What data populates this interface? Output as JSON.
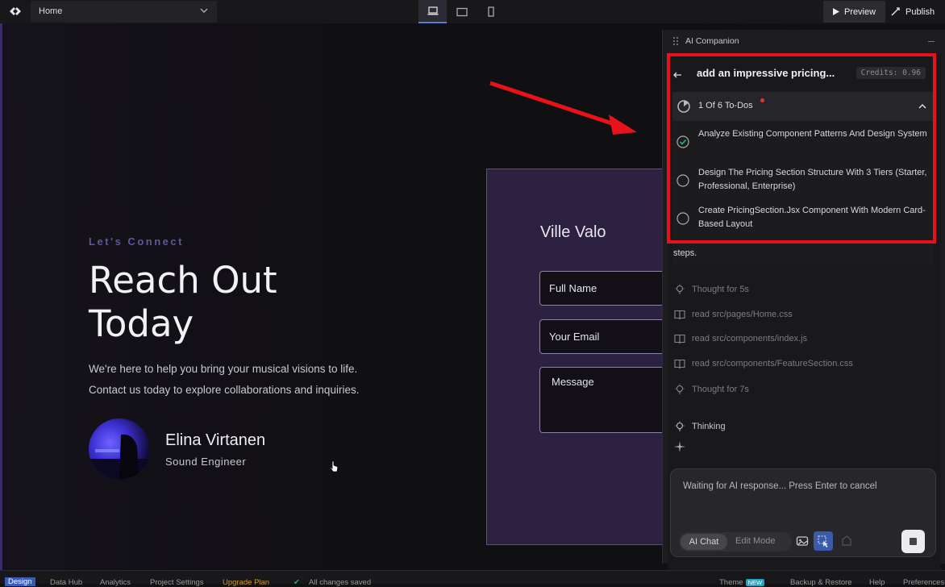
{
  "topbar": {
    "page_select": "Home",
    "preview_label": "Preview",
    "publish_label": "Publish"
  },
  "canvas": {
    "kicker": "Let's Connect",
    "title_line1": "Reach Out",
    "title_line2": "Today",
    "desc_line1": "We're here to help you bring your musical visions to life.",
    "desc_line2": "Contact us today to explore collaborations and inquiries.",
    "person_name": "Elina Virtanen",
    "person_role": "Sound Engineer",
    "form_name": "Ville Valo",
    "field_name": "Full Name",
    "field_email": "Your Email",
    "field_message": "Message"
  },
  "ai": {
    "panel_title": "AI Companion",
    "task_title": "add an impressive pricing...",
    "credits": "Credits: 0.96",
    "todo_count": "1 Of 6 To-Dos",
    "todos": [
      {
        "text": "Analyze Existing Component Patterns And Design System",
        "done": true
      },
      {
        "text": "Design The Pricing Section Structure With 3 Tiers (Starter, Professional, Enterprise)",
        "done": false
      },
      {
        "text": "Create PricingSection.Jsx Component With Modern Card-Based Layout",
        "done": false
      }
    ],
    "steps_text": "steps.",
    "log": [
      {
        "text": "Thought for 5s",
        "icon": "bulb-icon"
      },
      {
        "text": "read src/pages/Home.css",
        "icon": "book-icon"
      },
      {
        "text": "read src/components/index.js",
        "icon": "book-icon"
      },
      {
        "text": "read src/components/FeatureSection.css",
        "icon": "book-icon"
      },
      {
        "text": "Thought for 7s",
        "icon": "bulb-icon"
      },
      {
        "text": "Thinking",
        "icon": "bulb-icon"
      }
    ],
    "input_placeholder": "Waiting for AI response... Press Enter to cancel",
    "mode_ai_chat": "AI Chat",
    "mode_edit": "Edit Mode"
  },
  "bottombar": {
    "design": "Design",
    "data_hub": "Data Hub",
    "analytics": "Analytics",
    "project_settings": "Project Settings",
    "upgrade": "Upgrade Plan",
    "saved": "All changes saved",
    "theme": "Theme",
    "theme_badge": "NEW",
    "backup": "Backup & Restore",
    "help": "Help",
    "preferences": "Preferences"
  },
  "colors": {
    "accent": "#3a5cb8",
    "highlight_box": "#e8121b",
    "kicker": "#5d5897",
    "form_card": "#2c2140",
    "upgrade": "#d39a2c",
    "saved_check": "#2fa36b"
  }
}
